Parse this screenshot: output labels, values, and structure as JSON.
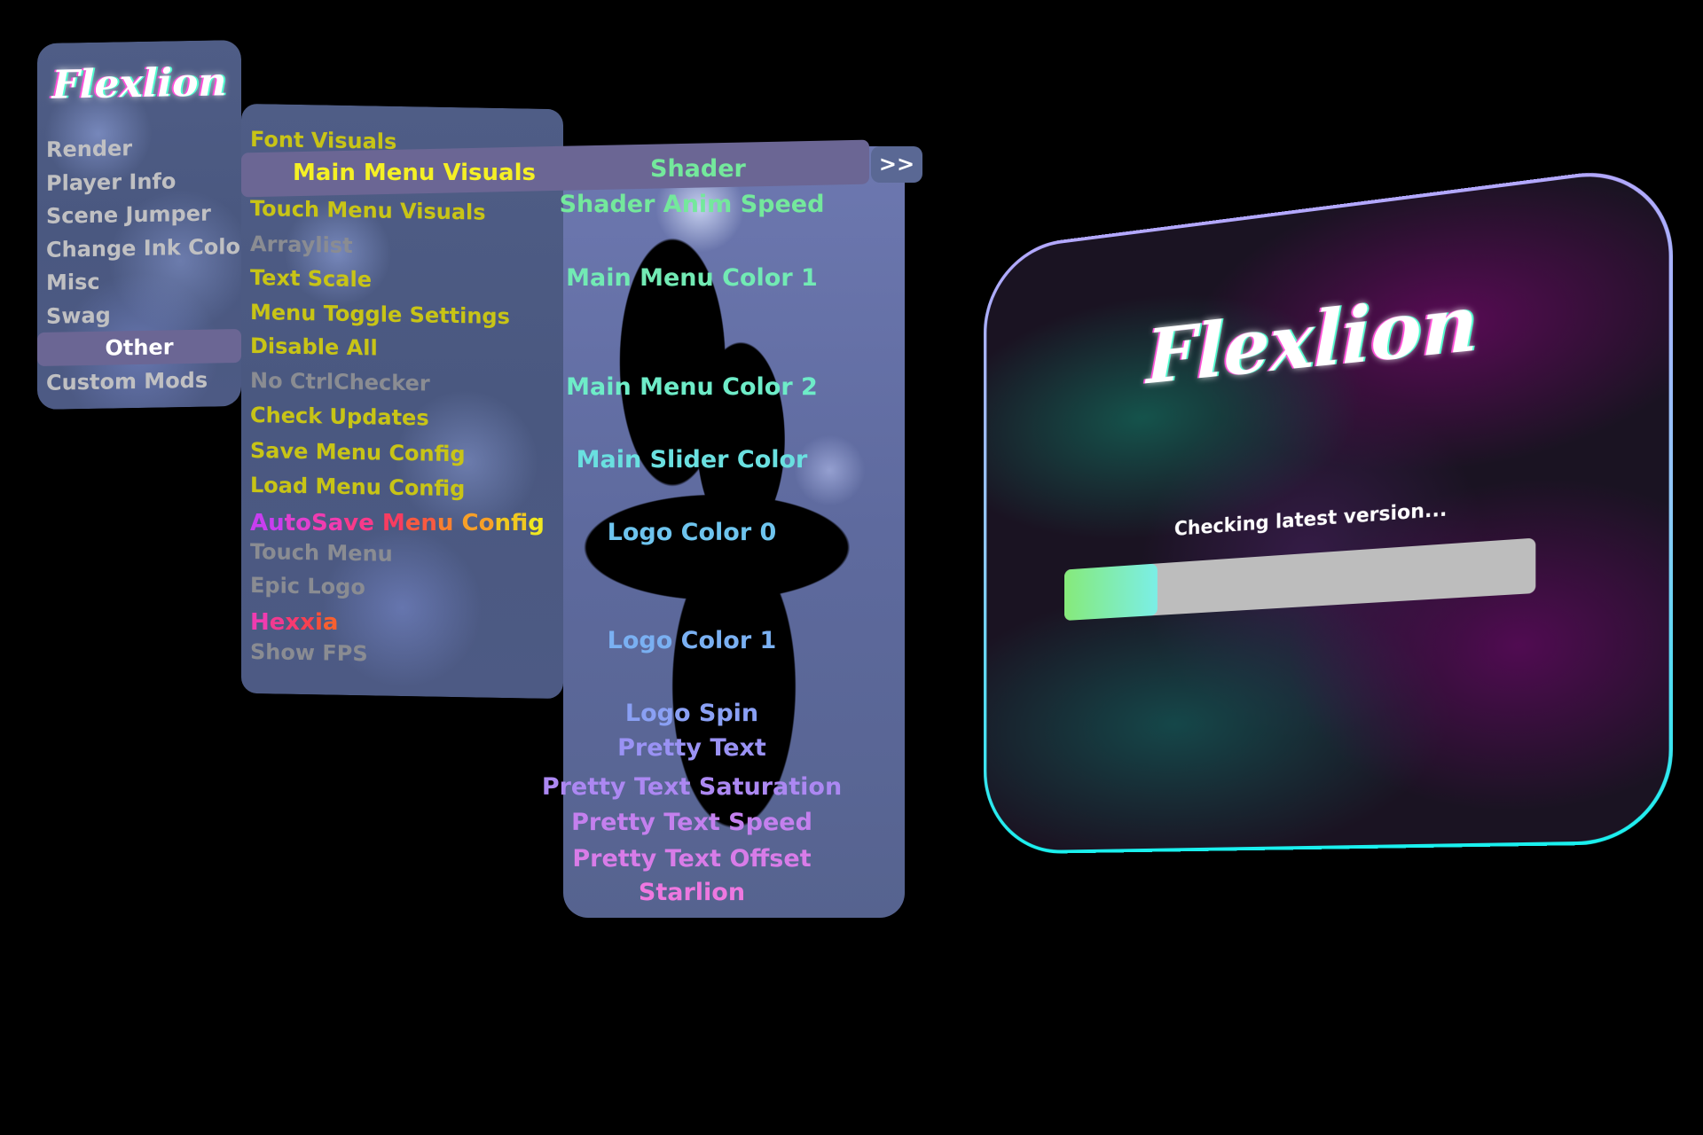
{
  "left_menu": {
    "logo": "Flexlion",
    "items": [
      "Render",
      "Player Info",
      "Scene Jumper",
      "Change Ink Color",
      "Misc",
      "Swag"
    ],
    "selected": "Other",
    "after_selected": [
      "Custom Mods"
    ]
  },
  "middle_menu": {
    "items_before": [
      {
        "label": "Font Visuals",
        "state": "enabled"
      }
    ],
    "selected": "Main Menu Visuals",
    "items_after": [
      {
        "label": "Touch Menu Visuals",
        "state": "enabled"
      },
      {
        "label": "Arraylist",
        "state": "disabled"
      },
      {
        "label": "Text Scale",
        "state": "enabled"
      },
      {
        "label": "Menu Toggle Settings",
        "state": "enabled"
      },
      {
        "label": "Disable All",
        "state": "enabled"
      },
      {
        "label": "No CtrlChecker",
        "state": "disabled"
      },
      {
        "label": "Check Updates",
        "state": "enabled"
      },
      {
        "label": "Save Menu Config",
        "state": "enabled"
      },
      {
        "label": "Load Menu Config",
        "state": "enabled"
      }
    ],
    "autosave": {
      "label": "AutoSave Menu Config",
      "state": "rainbow"
    },
    "items_after2": [
      {
        "label": "Touch Menu",
        "state": "disabled"
      },
      {
        "label": "Epic Logo",
        "state": "disabled"
      }
    ],
    "hexxia": {
      "label": "Hexxia",
      "state": "rainbow"
    },
    "items_after3": [
      {
        "label": "Show FPS",
        "state": "disabled"
      }
    ]
  },
  "submenu": {
    "selected": "Shader",
    "next_button": ">>",
    "items": [
      {
        "label": "Shader Anim Speed",
        "color": "#74e89c"
      },
      {
        "label": "Main Menu Color 1",
        "color": "#72eab4"
      },
      {
        "label": "Main Menu Color 2",
        "color": "#6eecc8"
      },
      {
        "label": "Main Slider Color",
        "color": "#6ae0e0"
      },
      {
        "label": "Logo Color 0",
        "color": "#6ec4ee"
      },
      {
        "label": "Logo Color 1",
        "color": "#7ab0f2"
      },
      {
        "label": "Logo Spin",
        "color": "#8aa0f4"
      },
      {
        "label": "Pretty Text",
        "color": "#9a92f4"
      },
      {
        "label": "Pretty Text Saturation",
        "color": "#ac88f2"
      },
      {
        "label": "Pretty Text Speed",
        "color": "#c480ee"
      },
      {
        "label": "Pretty Text Offset",
        "color": "#d87ce8"
      },
      {
        "label": "Starlion",
        "color": "#ee78e0"
      }
    ]
  },
  "loader": {
    "logo": "Flexlion",
    "status": "Checking latest version...",
    "progress": 0.21
  },
  "colors": {
    "enabled": "#c8c416",
    "disabled": "#8a8c92",
    "selected_text": "#f5f025",
    "highlight": "#6b6694"
  }
}
